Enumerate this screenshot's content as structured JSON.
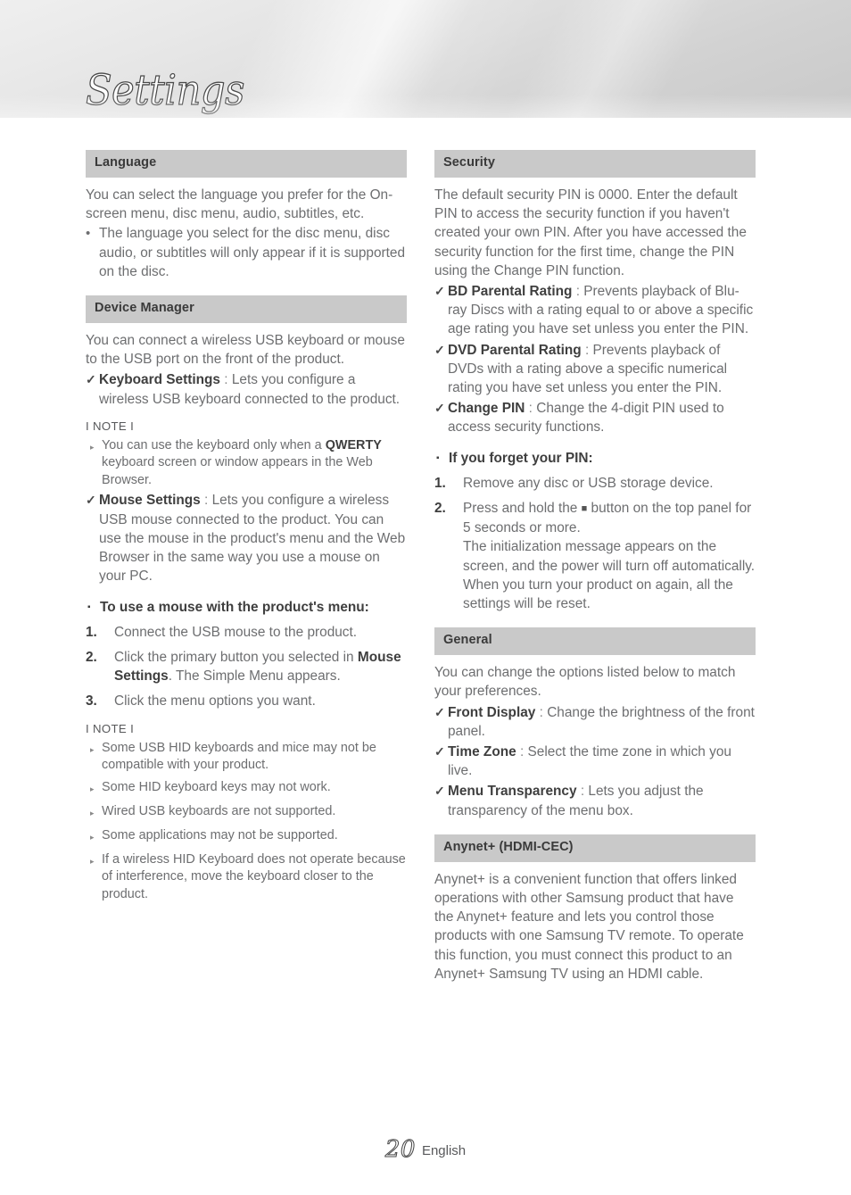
{
  "header": {
    "chapter_title": "Settings"
  },
  "footer": {
    "page_number": "20",
    "language": "English"
  },
  "icons": {
    "bullet_dot": "•",
    "bullet_check": "✓",
    "bullet_square": "▪",
    "bullet_triangle": "▸",
    "stop_button_symbol": "■"
  },
  "left_column": {
    "language": {
      "heading": "Language",
      "paragraph": "You can select the language you prefer for the On-screen menu, disc menu, audio, subtitles, etc.",
      "bullets": [
        "The language you select for the disc menu, disc audio, or subtitles will only appear if it is supported on the disc."
      ]
    },
    "device_manager": {
      "heading": "Device Manager",
      "paragraph": "You can connect a wireless USB keyboard or mouse to the USB port on the front of the product.",
      "keyboard_settings": {
        "term": "Keyboard Settings",
        "separator": ":",
        "description": "Lets you configure a wireless USB keyboard connected to the product."
      },
      "note_1": {
        "label": "I NOTE I",
        "items": [
          {
            "before": "You can use the keyboard only when a ",
            "bold": "QWERTY",
            "after": " keyboard screen or window appears in the Web Browser."
          }
        ]
      },
      "mouse_settings": {
        "term": "Mouse Settings",
        "separator": ":",
        "description": "Lets you configure a wireless USB mouse connected to the product. You can use the mouse in the product's menu and the Web Browser in the same way you use a mouse on your PC."
      },
      "mouse_menu_heading": "To use a mouse with the product's menu:",
      "steps": [
        {
          "number": "1.",
          "before": "Connect the USB mouse to the product.",
          "bold": "",
          "after": ""
        },
        {
          "number": "2.",
          "before": "Click the primary button you selected in ",
          "bold": "Mouse Settings",
          "after": ". The Simple Menu appears."
        },
        {
          "number": "3.",
          "before": "Click the menu options you want.",
          "bold": "",
          "after": ""
        }
      ],
      "note_2": {
        "label": "I NOTE I",
        "items": [
          "Some USB HID keyboards and mice may not be compatible with your product.",
          "Some HID keyboard keys may not work.",
          "Wired USB keyboards are not supported.",
          "Some applications may not be supported.",
          "If a wireless HID Keyboard does not operate because of interference, move the keyboard closer to the product."
        ]
      }
    }
  },
  "right_column": {
    "security": {
      "heading": "Security",
      "paragraph": "The default security PIN is 0000. Enter the default PIN to access the security function if you haven't created your own PIN. After you have accessed the security function for the first time, change the PIN using the Change PIN function.",
      "options": [
        {
          "term": "BD Parental Rating",
          "separator": ":",
          "description": "Prevents playback of Blu-ray Discs with a rating equal to or above a specific age rating you have set unless you enter the PIN."
        },
        {
          "term": "DVD Parental Rating",
          "separator": ":",
          "description": "Prevents playback of DVDs with a rating above a specific numerical rating you have set unless you enter the PIN."
        },
        {
          "term": "Change PIN",
          "separator": ":",
          "description": "Change the 4-digit PIN used to access security functions."
        }
      ],
      "forgot_pin_heading": "If you forget your PIN:",
      "forgot_pin_steps": [
        {
          "number": "1.",
          "before": "Remove any disc or USB storage device.",
          "symbol": "",
          "after": ""
        },
        {
          "number": "2.",
          "before": "Press and hold the ",
          "symbol": "■",
          "after": " button on the top panel for 5 seconds or more.\nThe initialization message appears on the screen, and the power will turn off automatically.\nWhen you turn your product on again, all the settings will be reset."
        }
      ]
    },
    "general": {
      "heading": "General",
      "paragraph": "You can change the options listed below to match your preferences.",
      "options": [
        {
          "term": "Front Display",
          "separator": ":",
          "description": "Change the brightness of the front panel."
        },
        {
          "term": "Time Zone",
          "separator": ":",
          "description": "Select the time zone in which you live."
        },
        {
          "term": "Menu Transparency",
          "separator": ":",
          "description": "Lets you adjust the transparency of the menu box."
        }
      ]
    },
    "anynet": {
      "heading": "Anynet+ (HDMI-CEC)",
      "paragraph": "Anynet+ is a convenient function that offers linked operations with other Samsung product that have the Anynet+ feature and lets you control those products with one Samsung TV remote. To operate this function, you must connect this product to an Anynet+ Samsung TV using an HDMI cable."
    }
  }
}
